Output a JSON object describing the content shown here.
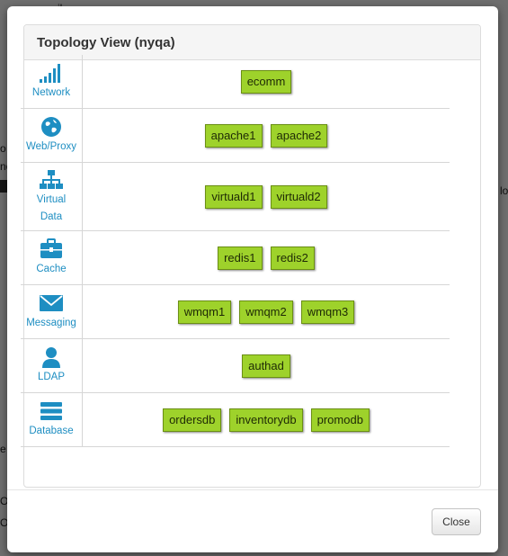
{
  "background": {
    "fragments": [
      "il",
      "o",
      "nc",
      "lo",
      "e",
      "O",
      "O"
    ]
  },
  "modal": {
    "title": "Topology View (nyqa)",
    "accent_color": "#1e8ec2",
    "node_color": "#9ed22b",
    "close_label": "Close"
  },
  "topology": [
    {
      "label": "Network",
      "icon": "signal-bars-icon",
      "nodes": [
        "ecomm"
      ]
    },
    {
      "label": "Web/Proxy",
      "icon": "globe-icon",
      "nodes": [
        "apache1",
        "apache2"
      ]
    },
    {
      "label": "Virtual Data",
      "label_lines": [
        "Virtual",
        "Data"
      ],
      "icon": "hierarchy-icon",
      "nodes": [
        "virtuald1",
        "virtuald2"
      ]
    },
    {
      "label": "Cache",
      "icon": "briefcase-icon",
      "nodes": [
        "redis1",
        "redis2"
      ]
    },
    {
      "label": "Messaging",
      "icon": "envelope-icon",
      "nodes": [
        "wmqm1",
        "wmqm2",
        "wmqm3"
      ]
    },
    {
      "label": "LDAP",
      "icon": "user-icon",
      "nodes": [
        "authad"
      ]
    },
    {
      "label": "Database",
      "icon": "list-icon",
      "nodes": [
        "ordersdb",
        "inventorydb",
        "promodb"
      ]
    }
  ]
}
